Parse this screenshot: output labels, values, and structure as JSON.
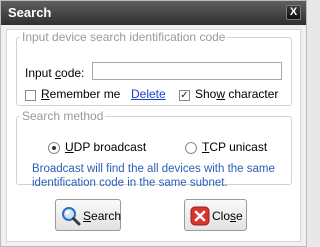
{
  "window": {
    "title": "Search",
    "close_glyph": "X"
  },
  "identification": {
    "legend": "Input device search identification code",
    "input_label_pre": "Input ",
    "input_label_key": "c",
    "input_label_post": "ode:",
    "input_value": "",
    "remember_pre": "",
    "remember_key": "R",
    "remember_post": "emember me",
    "remember_checked": false,
    "delete_label": "Delete",
    "show_pre": "Sho",
    "show_key": "w",
    "show_post": " character",
    "show_checked": true
  },
  "method": {
    "legend": "Search method",
    "udp_key": "U",
    "udp_post": "DP broadcast",
    "udp_selected": true,
    "tcp_key": "T",
    "tcp_post": "CP unicast",
    "tcp_selected": false,
    "note": "Broadcast will find the all devices with the same identification code in the same subnet."
  },
  "buttons": {
    "search_key": "S",
    "search_post": "earch",
    "search_icon": "magnifier-icon",
    "close_pre": "Clo",
    "close_key": "s",
    "close_post": "e",
    "close_icon": "close-x-icon"
  },
  "colors": {
    "note_text": "#2a5fb8",
    "link": "#1c3ec8",
    "titlebar": "#3c3c3c"
  }
}
